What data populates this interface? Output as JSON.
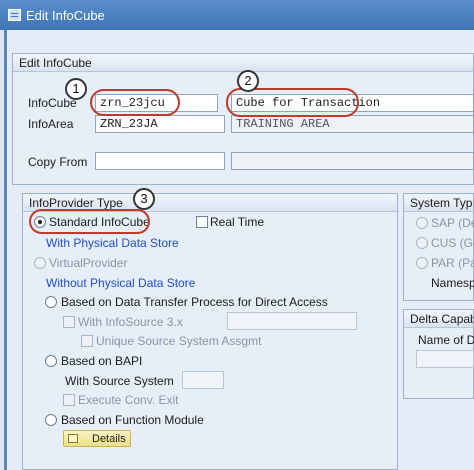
{
  "window": {
    "title": "Edit InfoCube"
  },
  "edit_group": {
    "title": "Edit InfoCube",
    "infocube_label": "InfoCube",
    "infocube_value": "zrn_23jcu",
    "description_value": "Cube for Transaction",
    "infoarea_label": "InfoArea",
    "infoarea_value": "ZRN_23JA",
    "infoarea_text": "TRAINING AREA",
    "copy_from_label": "Copy From",
    "copy_from_value": "",
    "copy_from_text": ""
  },
  "provider_group": {
    "title": "InfoProvider Type",
    "standard_label": "Standard InfoCube",
    "realtime_label": "Real Time",
    "with_physical_label": "With Physical Data Store",
    "virtual_label": "VirtualProvider",
    "without_physical_label": "Without Physical Data Store",
    "dtp_label": "Based on Data Transfer Process for Direct Access",
    "with_infosource_label": "With InfoSource 3.x",
    "unique_source_label": "Unique Source System Assgmt",
    "bapi_label": "Based on BAPI",
    "with_source_system_label": "With Source System",
    "execute_conv_label": "Execute Conv. Exit",
    "function_module_label": "Based on Function Module",
    "details_label": "Details"
  },
  "system_group": {
    "title": "System Type",
    "options": [
      "SAP (Dei",
      "CUS (Ge",
      "PAR (Par"
    ],
    "namespace_label": "Namespa"
  },
  "delta_group": {
    "title": "Delta Capabili",
    "name_label": "Name of De"
  },
  "callouts": [
    "1",
    "2",
    "3"
  ],
  "colors": {
    "accent": "#3f74b6",
    "callout": "#c0392b",
    "link": "#1f4fd1"
  }
}
